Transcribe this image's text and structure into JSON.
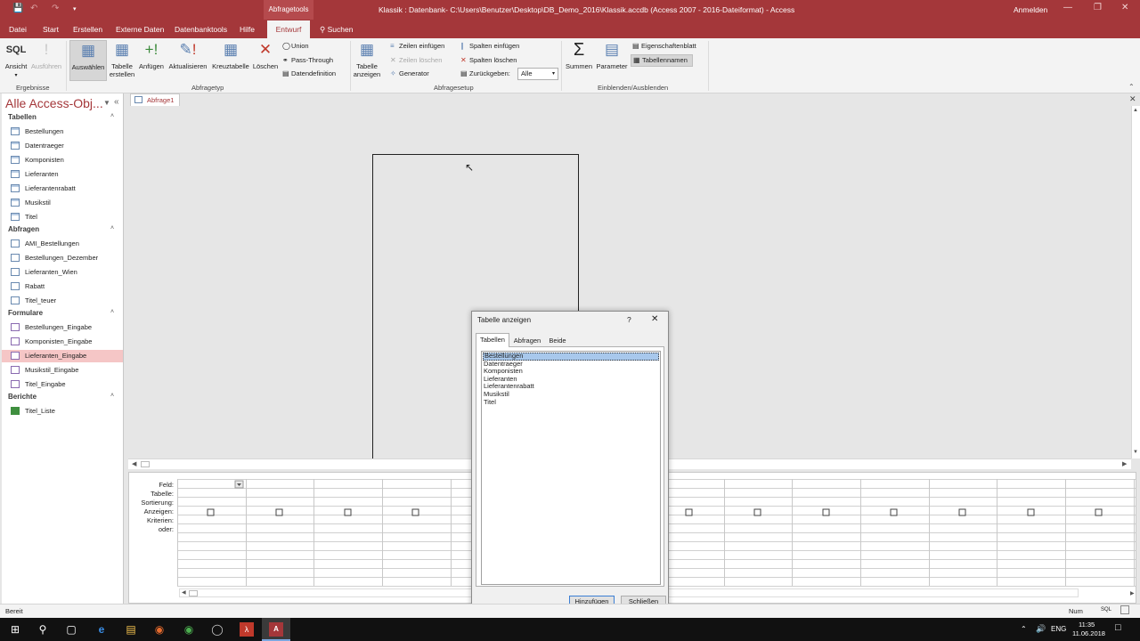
{
  "window": {
    "context_tab": "Abfragetools",
    "title": "Klassik : Datenbank- C:\\Users\\Benutzer\\Desktop\\DB_Demo_2016\\Klassik.accdb (Access 2007 - 2016-Dateiformat)  -  Access",
    "sign_in": "Anmelden"
  },
  "menu": {
    "tabs": [
      "Datei",
      "Start",
      "Erstellen",
      "Externe Daten",
      "Datenbanktools",
      "Hilfe"
    ],
    "active_tab": "Entwurf",
    "search": "Suchen"
  },
  "ribbon": {
    "groups": {
      "ergebnisse": "Ergebnisse",
      "abfragetyp": "Abfragetyp",
      "abfragesetup": "Abfragesetup",
      "einblenden": "Einblenden/Ausblenden"
    },
    "buttons": {
      "ansicht": "Ansicht",
      "ansicht_sql": "SQL",
      "ausfuehren": "Ausführen",
      "auswaehlen": "Auswählen",
      "tabelle_erstellen_1": "Tabelle",
      "tabelle_erstellen_2": "erstellen",
      "anfuegen": "Anfügen",
      "aktualisieren": "Aktualisieren",
      "kreuztabelle": "Kreuztabelle",
      "loeschen": "Löschen",
      "union": "Union",
      "pass_through": "Pass-Through",
      "datendefinition": "Datendefinition",
      "tabelle_anzeigen_1": "Tabelle",
      "tabelle_anzeigen_2": "anzeigen",
      "zeilen_einfuegen": "Zeilen einfügen",
      "zeilen_loeschen": "Zeilen löschen",
      "generator": "Generator",
      "spalten_einfuegen": "Spalten einfügen",
      "spalten_loeschen": "Spalten löschen",
      "zurueckgeben": "Zurückgeben:",
      "zurueckgeben_value": "Alle",
      "summen": "Summen",
      "parameter": "Parameter",
      "eigenschaftenblatt": "Eigenschaftenblatt",
      "tabellennamen": "Tabellennamen"
    }
  },
  "nav": {
    "title": "Alle Access-Obj...",
    "sections": [
      {
        "name": "Tabellen",
        "kind": "table",
        "items": [
          "Bestellungen",
          "Datentraeger",
          "Komponisten",
          "Lieferanten",
          "Lieferantenrabatt",
          "Musikstil",
          "Titel"
        ]
      },
      {
        "name": "Abfragen",
        "kind": "query",
        "items": [
          "AMI_Bestellungen",
          "Bestellungen_Dezember",
          "Lieferanten_Wien",
          "Rabatt",
          "Titel_teuer"
        ]
      },
      {
        "name": "Formulare",
        "kind": "form",
        "items": [
          "Bestellungen_Eingabe",
          "Komponisten_Eingabe",
          "Lieferanten_Eingabe",
          "Musikstil_Eingabe",
          "Titel_Eingabe"
        ]
      },
      {
        "name": "Berichte",
        "kind": "report",
        "items": [
          "Titel_Liste"
        ]
      }
    ],
    "selected": "Lieferanten_Eingabe"
  },
  "document": {
    "tab": "Abfrage1"
  },
  "qbe": {
    "row_labels": [
      "Feld:",
      "Tabelle:",
      "Sortierung:",
      "Anzeigen:",
      "Kriterien:",
      "oder:"
    ]
  },
  "dialog": {
    "title": "Tabelle anzeigen",
    "help": "?",
    "tabs": [
      "Tabellen",
      "Abfragen",
      "Beide"
    ],
    "active_tab": "Tabellen",
    "list": [
      "Bestellungen",
      "Datentraeger",
      "Komponisten",
      "Lieferanten",
      "Lieferantenrabatt",
      "Musikstil",
      "Titel"
    ],
    "selected": "Bestellungen",
    "add_button": "Hinzufügen",
    "close_button": "Schließen"
  },
  "status": {
    "left": "Bereit",
    "num": "Num",
    "sql": "SQL"
  },
  "taskbar": {
    "lang": "ENG",
    "time": "11:35",
    "date": "11.06.2018"
  }
}
